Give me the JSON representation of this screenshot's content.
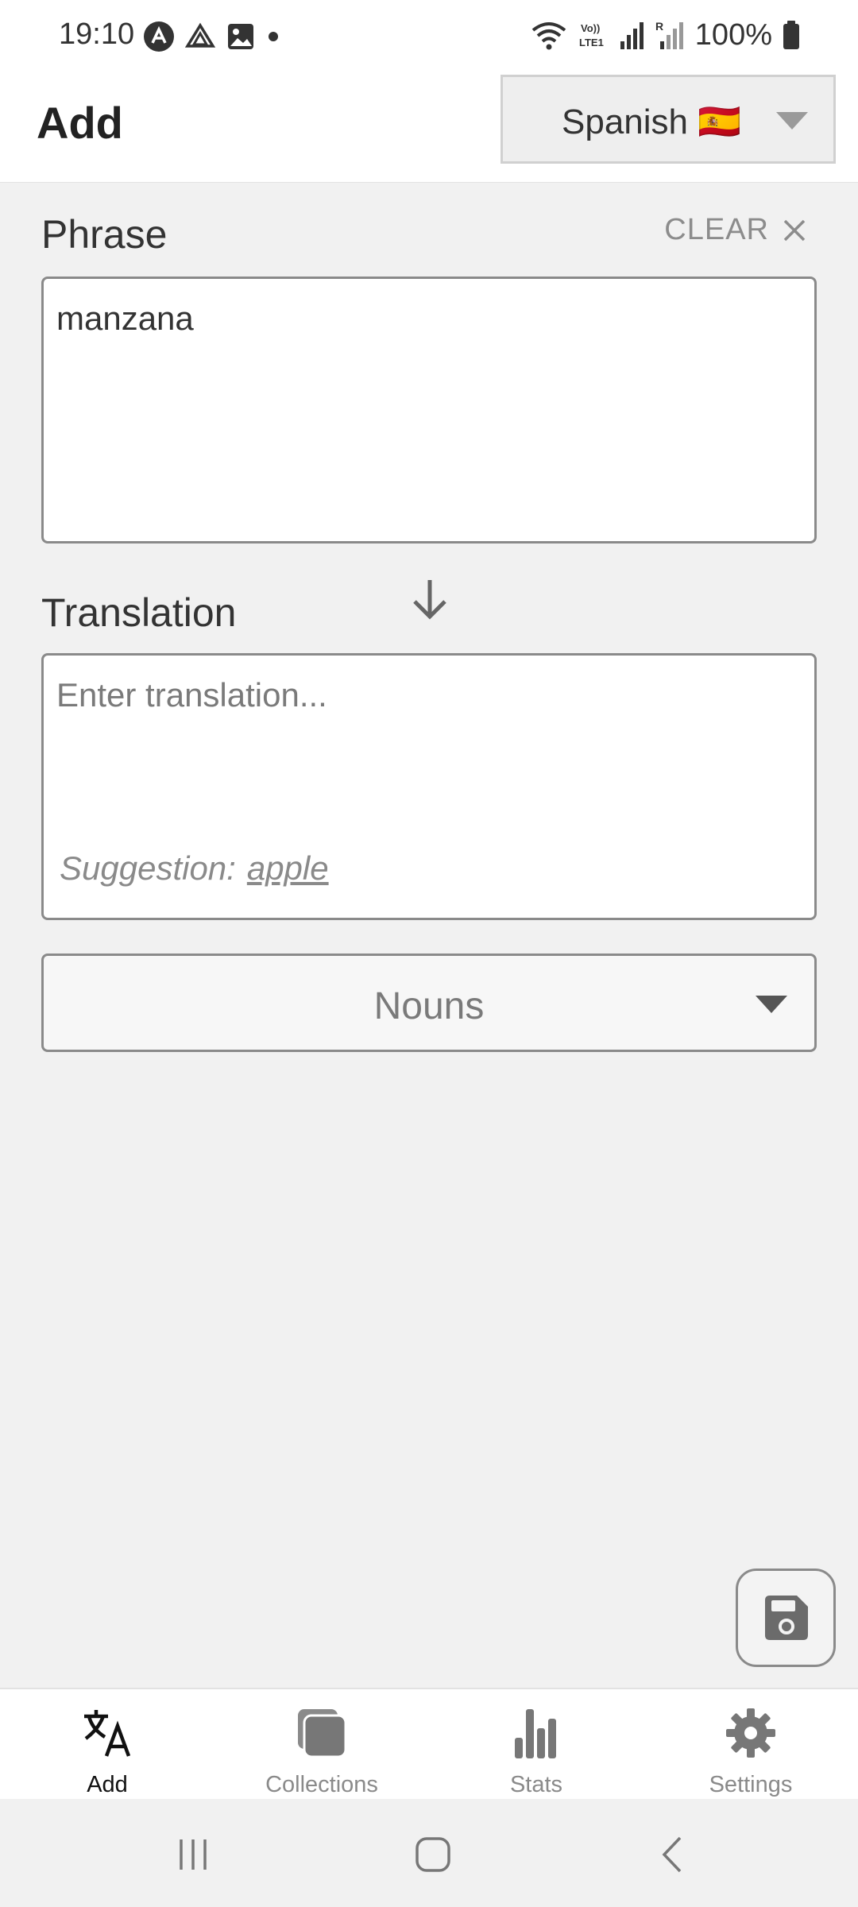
{
  "status_bar": {
    "time": "19:10",
    "battery_percent": "100%",
    "icons_left": [
      "app-icon",
      "drive-icon",
      "gallery-icon",
      "dot-icon"
    ],
    "icons_right": [
      "wifi-icon",
      "volte-icon",
      "signal-icon",
      "signal-roaming-icon",
      "battery-icon"
    ]
  },
  "header": {
    "title": "Add",
    "language_select": "Spanish 🇪🇸"
  },
  "form": {
    "phrase_label": "Phrase",
    "clear_label": "CLEAR",
    "phrase_value": "manzana",
    "translation_label": "Translation",
    "translation_placeholder": "Enter translation...",
    "suggestion_prefix": "Suggestion:",
    "suggestion_word": "apple",
    "category_select": "Nouns"
  },
  "bottom_nav": {
    "items": [
      {
        "label": "Add",
        "icon": "translate-icon",
        "active": true
      },
      {
        "label": "Collections",
        "icon": "collections-icon",
        "active": false
      },
      {
        "label": "Stats",
        "icon": "bar-chart-icon",
        "active": false
      },
      {
        "label": "Settings",
        "icon": "gear-icon",
        "active": false
      }
    ]
  },
  "colors": {
    "background": "#f1f1f1",
    "surface": "#ffffff",
    "border": "#8a8a8a",
    "muted_text": "#8a8a8a"
  }
}
